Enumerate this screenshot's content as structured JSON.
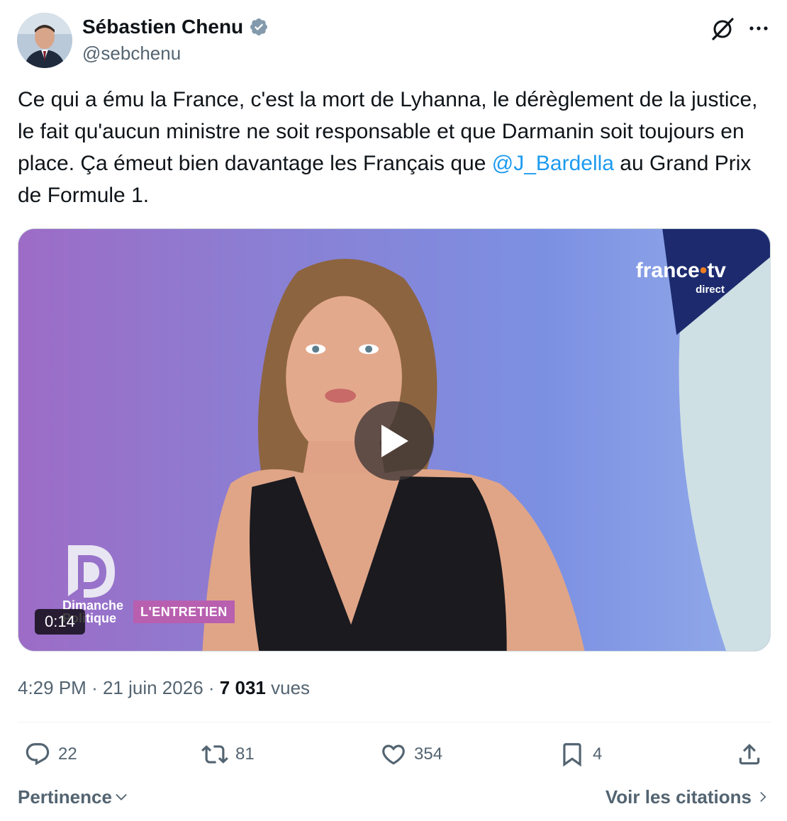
{
  "author": {
    "display_name": "Sébastien Chenu",
    "handle": "@sebchenu"
  },
  "tweet": {
    "text_before": "Ce qui a ému la France, c'est la mort de Lyhanna, le dérèglement de la justice, le fait qu'aucun ministre ne soit responsable et que Darmanin soit toujours en place. Ça émeut bien davantage les Français que ",
    "mention": "@J_Bardella",
    "text_after": " au Grand Prix de Formule 1."
  },
  "media": {
    "broadcaster": "france",
    "broadcaster_suffix": "tv",
    "broadcaster_sub": "direct",
    "show_line1": "Dimanche",
    "show_line2": "Politique",
    "segment": "L'ENTRETIEN",
    "duration": "0:14"
  },
  "meta": {
    "time": "4:29 PM",
    "date": "21 juin 2026",
    "separator": "·",
    "views_count": "7 031",
    "views_label": "vues"
  },
  "actions": {
    "replies": "22",
    "retweets": "81",
    "likes": "354",
    "bookmarks": "4"
  },
  "footer": {
    "sort_label": "Pertinence",
    "quotes_label": "Voir les citations"
  },
  "colors": {
    "accent": "#1d9bf0",
    "muted": "#536471",
    "text": "#0f1419"
  }
}
